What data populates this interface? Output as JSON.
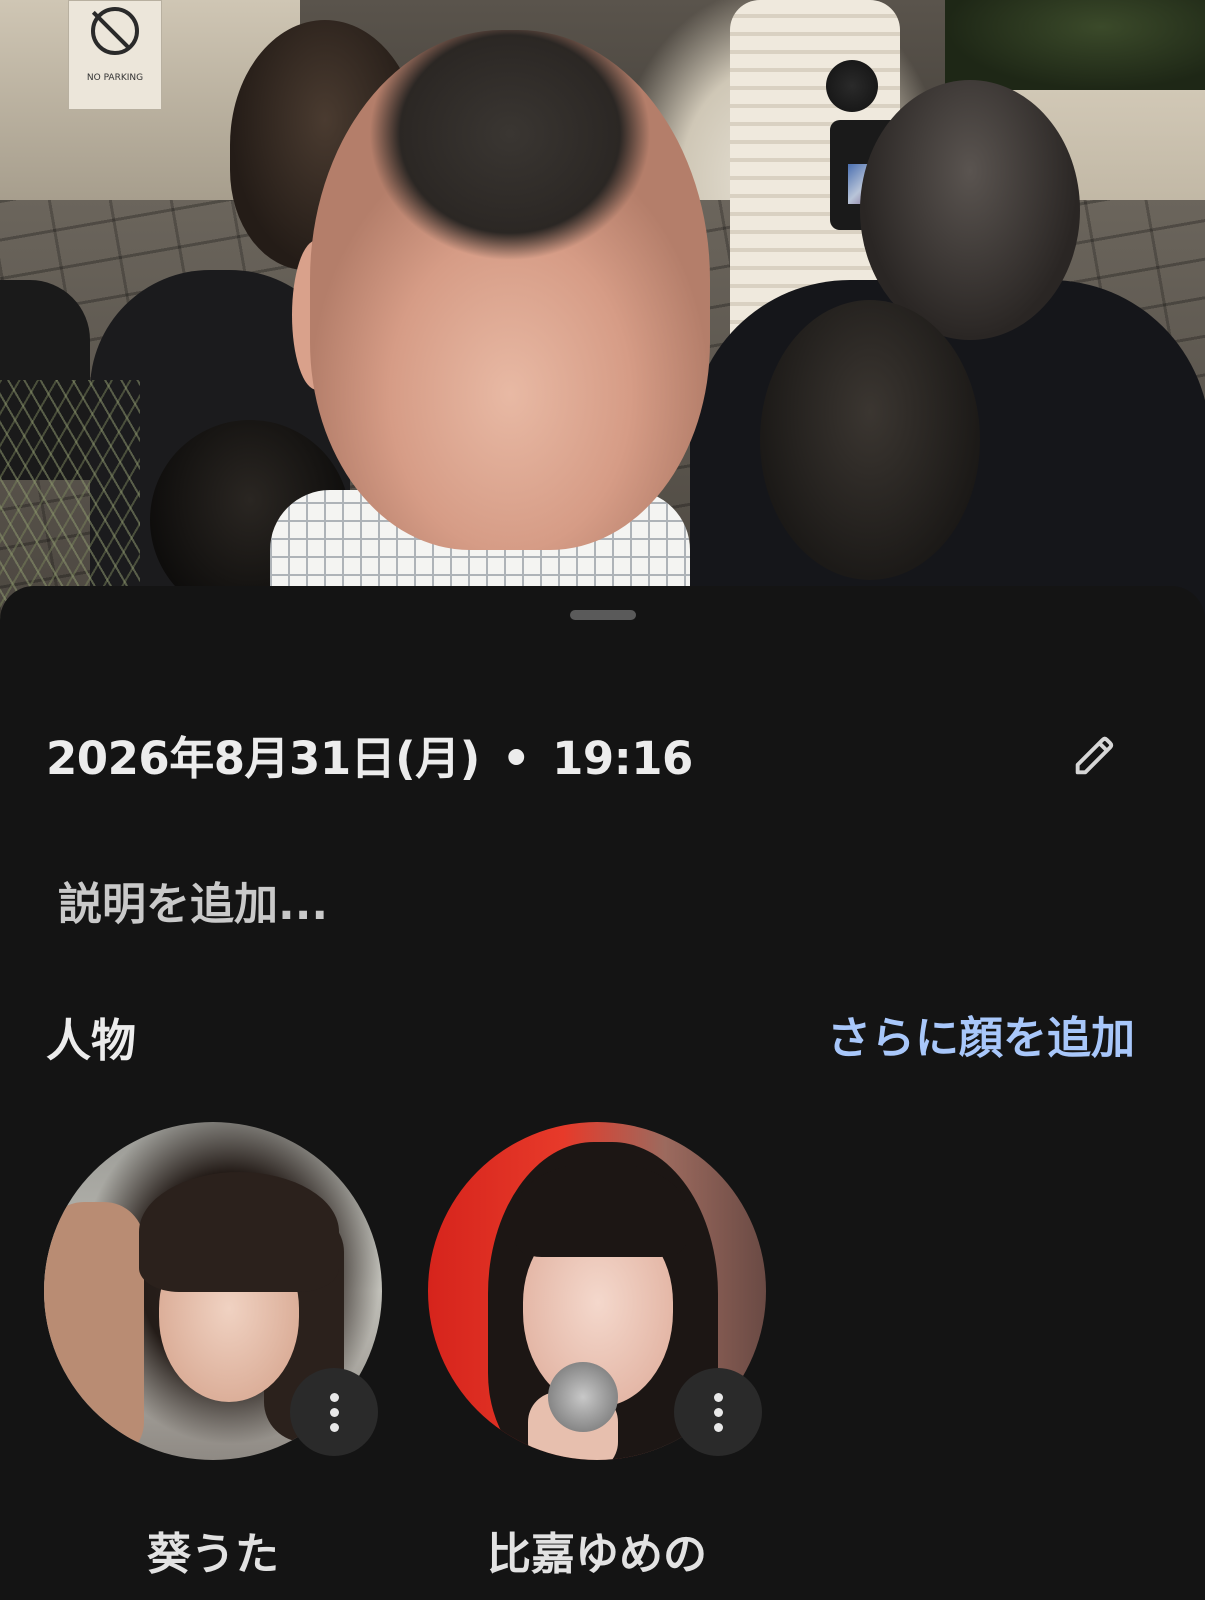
{
  "info_panel": {
    "date": "2026年8月31日(月)",
    "separator": "•",
    "time": "19:16",
    "edit_icon": "pencil-icon",
    "description_placeholder": "説明を追加..."
  },
  "people": {
    "title": "人物",
    "add_faces_label": "さらに顔を追加",
    "more_icon": "more-vert-icon",
    "items": [
      {
        "name": "葵うた"
      },
      {
        "name": "比嘉ゆめの"
      }
    ]
  },
  "photo": {
    "sign_text": "NO PARKING"
  },
  "colors": {
    "background": "#141414",
    "accent": "#a8c7fa",
    "text_primary": "#ececec",
    "text_secondary": "#c9c9c9"
  }
}
